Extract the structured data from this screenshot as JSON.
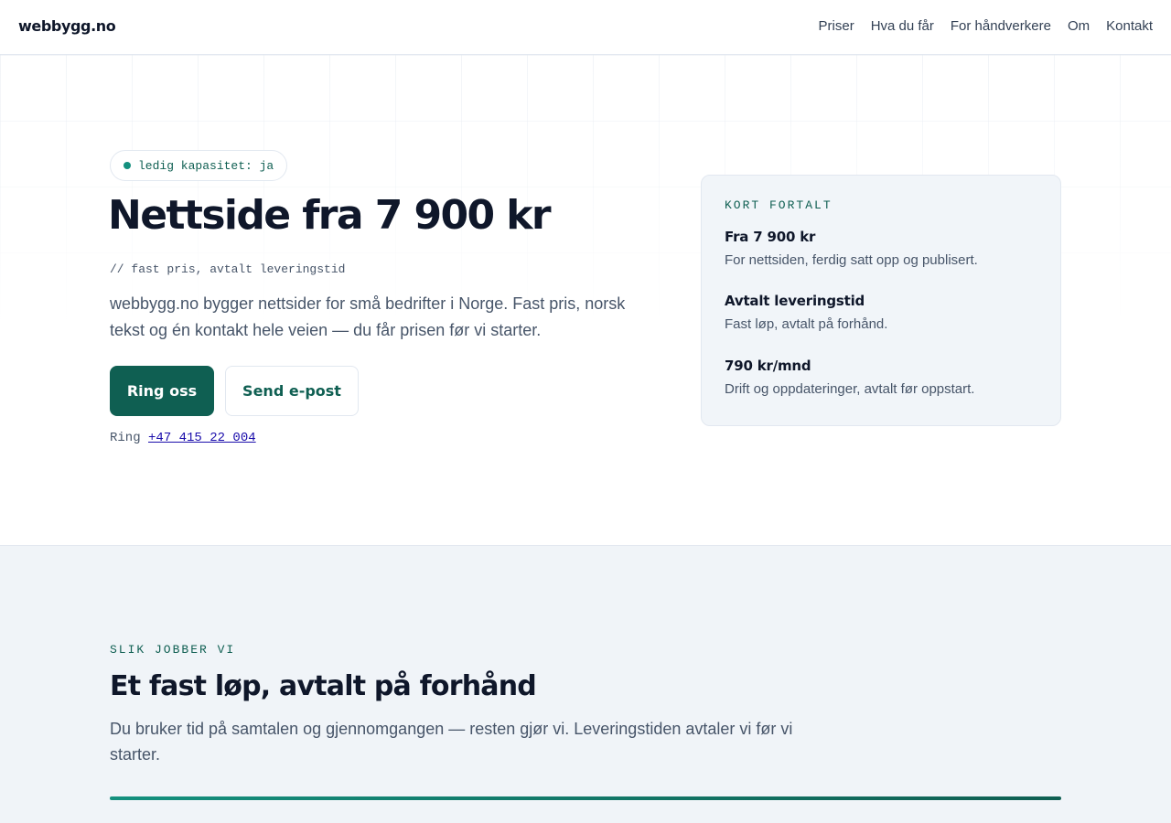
{
  "header": {
    "logo": "webbygg.no",
    "nav": [
      "Priser",
      "Hva du får",
      "For håndverkere",
      "Om",
      "Kontakt"
    ]
  },
  "hero": {
    "status_pill": "ledig kapasitet: ja",
    "title": "Nettside fra 7 900 kr",
    "subtitle": "// fast pris, avtalt leveringstid",
    "description": "webbygg.no bygger nettsider for små bedrifter i Norge. Fast pris, norsk tekst og én kontakt hele veien — du får prisen før vi starter.",
    "primary_button": "Ring oss",
    "secondary_button": "Send e-post",
    "phone_prefix": "Ring",
    "phone_number": "+47 415 22 004"
  },
  "summary_card": {
    "label": "KORT FORTALT",
    "items": [
      {
        "title": "Fra 7 900 kr",
        "text": "For nettsiden, ferdig satt opp og publisert."
      },
      {
        "title": "Avtalt leveringstid",
        "text": "Fast løp, avtalt på forhånd."
      },
      {
        "title": "790 kr/mnd",
        "text": "Drift og oppdateringer, avtalt før oppstart."
      }
    ]
  },
  "process_section": {
    "label": "SLIK JOBBER VI",
    "title": "Et fast løp, avtalt på forhånd",
    "description": "Du bruker tid på samtalen og gjennomgangen — resten gjør vi. Leveringstiden avtaler vi før vi starter."
  },
  "colors": {
    "accent": "#0f5f52",
    "accent_light": "#14907e",
    "text": "#0f172a",
    "muted": "#475569",
    "card_bg": "#f1f5f9"
  },
  "icons": {
    "status": "status-dot-icon"
  }
}
